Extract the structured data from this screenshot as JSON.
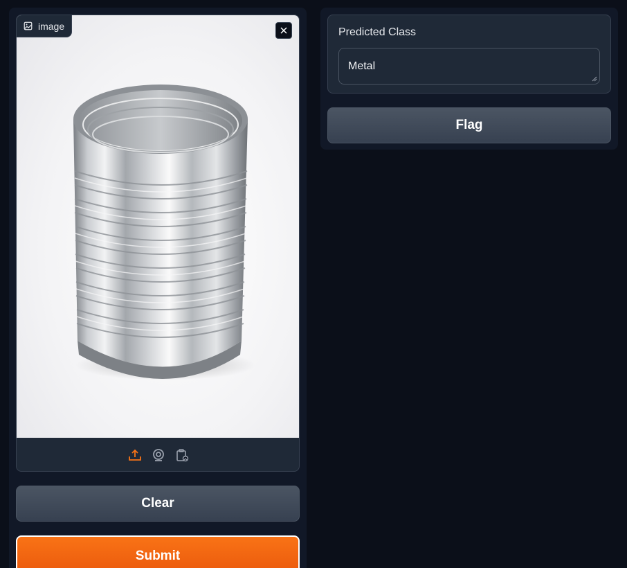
{
  "input": {
    "image_label": "image",
    "image_alt": "tin can",
    "clear_label": "Clear",
    "submit_label": "Submit",
    "toolbar_icons": [
      "upload-icon",
      "webcam-icon",
      "clipboard-icon"
    ]
  },
  "output": {
    "label": "Predicted Class",
    "value": "Metal",
    "flag_label": "Flag"
  },
  "colors": {
    "background": "#0b0f19",
    "panel": "#111827",
    "block": "#1f2937",
    "accent": "#f97316",
    "secondary_button": "#4b5563"
  }
}
